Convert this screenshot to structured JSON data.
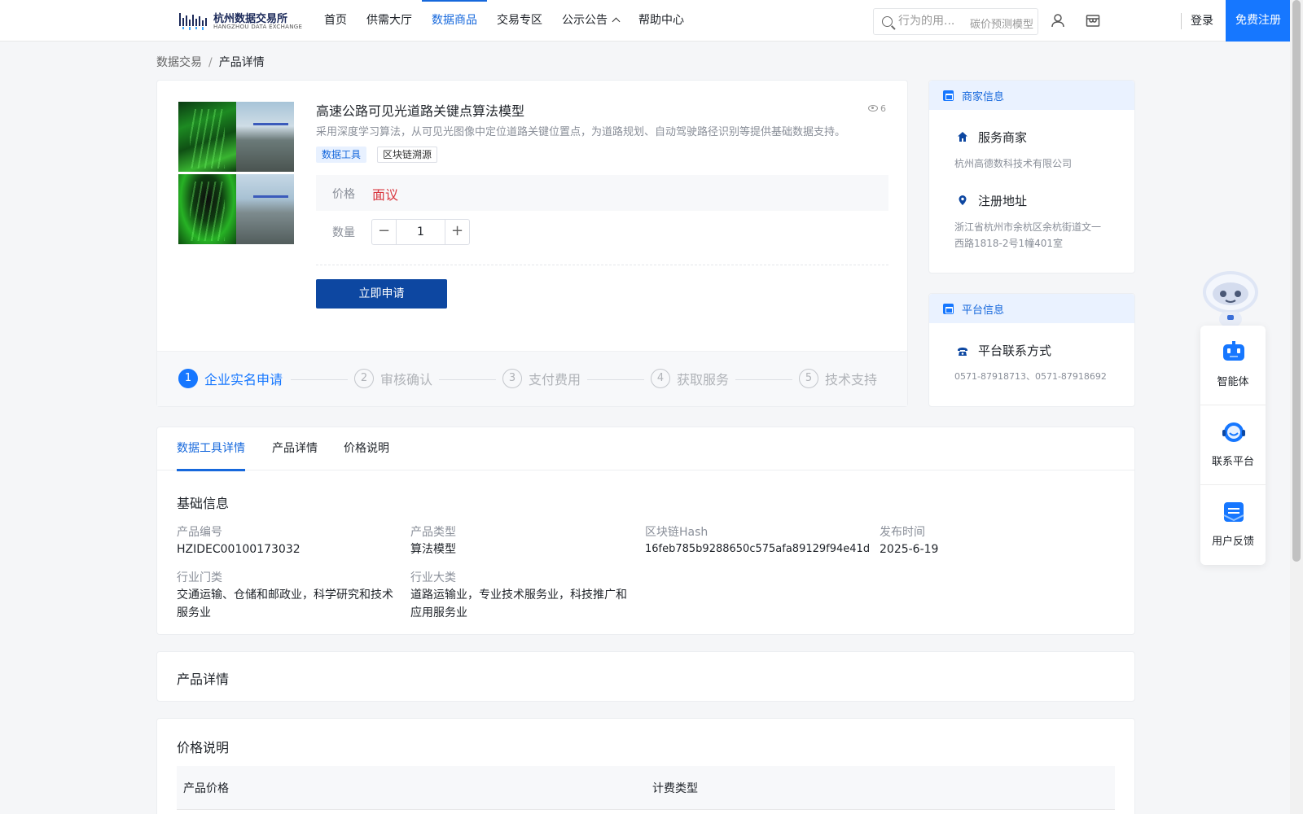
{
  "header": {
    "logo_name": "杭州数据交易所",
    "logo_sub": "HANGZHOU DATA EXCHANGE",
    "nav": [
      {
        "label": "首页"
      },
      {
        "label": "供需大厅"
      },
      {
        "label": "数据商品",
        "active": true
      },
      {
        "label": "交易专区"
      },
      {
        "label": "公示公告",
        "has_chevron": true
      },
      {
        "label": "帮助中心"
      }
    ],
    "search_placeholder": "行为的用...",
    "search_hint": "碳价预测模型",
    "login": "登录",
    "register": "免费注册",
    "accent_color": "#1677ff"
  },
  "breadcrumb": {
    "parent": "数据交易",
    "separator": "/",
    "current": "产品详情"
  },
  "product": {
    "title": "高速公路可见光道路关键点算法模型",
    "views": "6",
    "description": "采用深度学习算法，从可见光图像中定位道路关键位置点，为道路规划、自动驾驶路径识别等提供基础数据支持。",
    "tags": [
      "数据工具",
      "区块链溯源"
    ],
    "price_label": "价格",
    "price_value": "面议",
    "quantity_label": "数量",
    "quantity_value": "1",
    "apply_button": "立即申请",
    "price_color": "#d9363e",
    "button_color": "#0d47a1"
  },
  "steps": [
    {
      "num": "1",
      "label": "企业实名申请",
      "active": true
    },
    {
      "num": "2",
      "label": "审核确认"
    },
    {
      "num": "3",
      "label": "支付费用"
    },
    {
      "num": "4",
      "label": "获取服务"
    },
    {
      "num": "5",
      "label": "技术支持"
    }
  ],
  "merchant": {
    "header": "商家信息",
    "service_label": "服务商家",
    "service_value": "杭州高德数科技术有限公司",
    "address_label": "注册地址",
    "address_value": "浙江省杭州市余杭区余杭街道文一西路1818-2号1幢401室"
  },
  "platform": {
    "header": "平台信息",
    "contact_label": "平台联系方式",
    "contact_value": "0571-87918713、0571-87918692"
  },
  "float_panel": {
    "items": [
      {
        "label": "智能体",
        "icon": "robot-icon"
      },
      {
        "label": "联系平台",
        "icon": "headset-icon"
      },
      {
        "label": "用户反馈",
        "icon": "feedback-icon"
      }
    ]
  },
  "tabs": [
    {
      "label": "数据工具详情",
      "active": true
    },
    {
      "label": "产品详情"
    },
    {
      "label": "价格说明"
    }
  ],
  "basic_info": {
    "title": "基础信息",
    "fields": [
      {
        "label": "产品编号",
        "value": "HZIDEC00100173032"
      },
      {
        "label": "产品类型",
        "value": "算法模型"
      },
      {
        "label": "区块链Hash",
        "value": "16feb785b9288650c575afa89129f94e41d..."
      },
      {
        "label": "发布时间",
        "value": "2025-6-19"
      },
      {
        "label": "行业门类",
        "value": "交通运输、仓储和邮政业，科学研究和技术服务业"
      },
      {
        "label": "行业大类",
        "value": "道路运输业，专业技术服务业，科技推广和应用服务业"
      }
    ]
  },
  "product_details": {
    "title": "产品详情"
  },
  "price_section": {
    "title": "价格说明",
    "columns": [
      "产品价格",
      "计费类型"
    ]
  }
}
